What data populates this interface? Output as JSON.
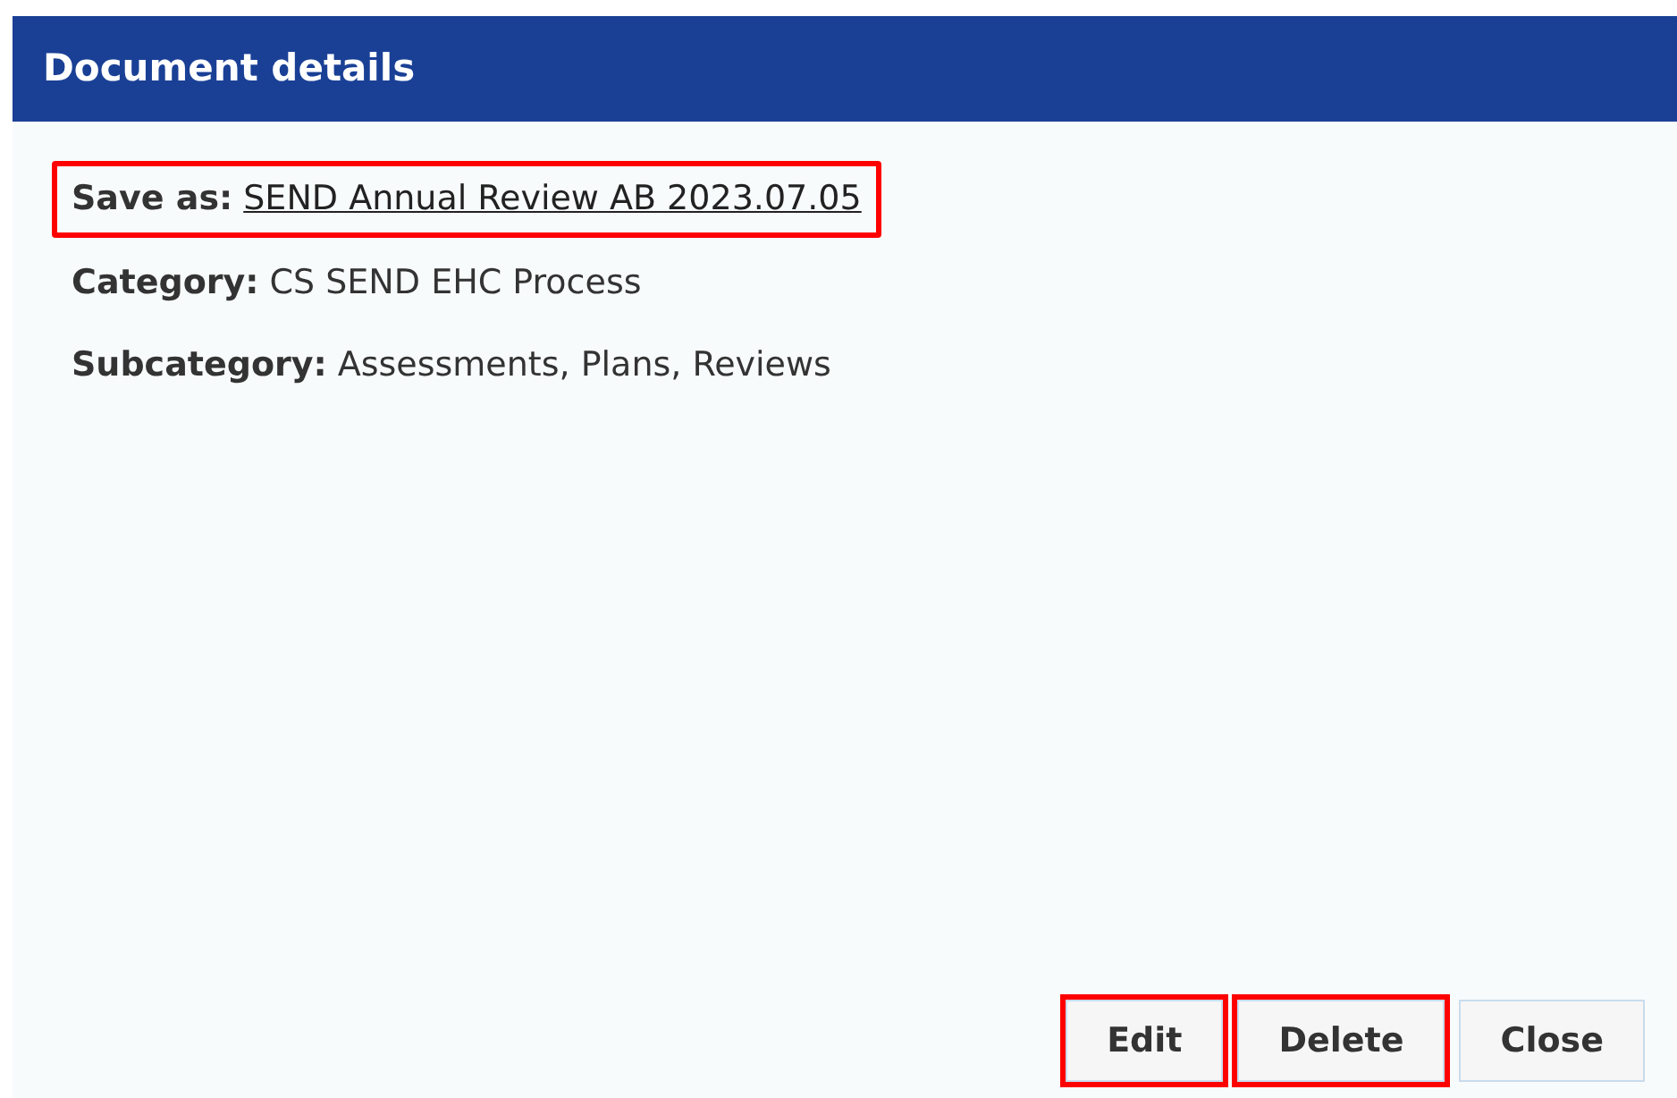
{
  "dialog": {
    "title": "Document details"
  },
  "details": [
    {
      "label": "Save as:",
      "value": "SEND Annual Review AB 2023.07.05",
      "kind": "link",
      "highlighted": true
    },
    {
      "label": "Category:",
      "value": "CS SEND EHC Process",
      "kind": "text",
      "highlighted": false
    },
    {
      "label": "Subcategory:",
      "value": "Assessments, Plans, Reviews",
      "kind": "text",
      "highlighted": false
    }
  ],
  "buttons": [
    {
      "label": "Edit",
      "highlighted": true
    },
    {
      "label": "Delete",
      "highlighted": true
    },
    {
      "label": "Close",
      "highlighted": false
    }
  ]
}
